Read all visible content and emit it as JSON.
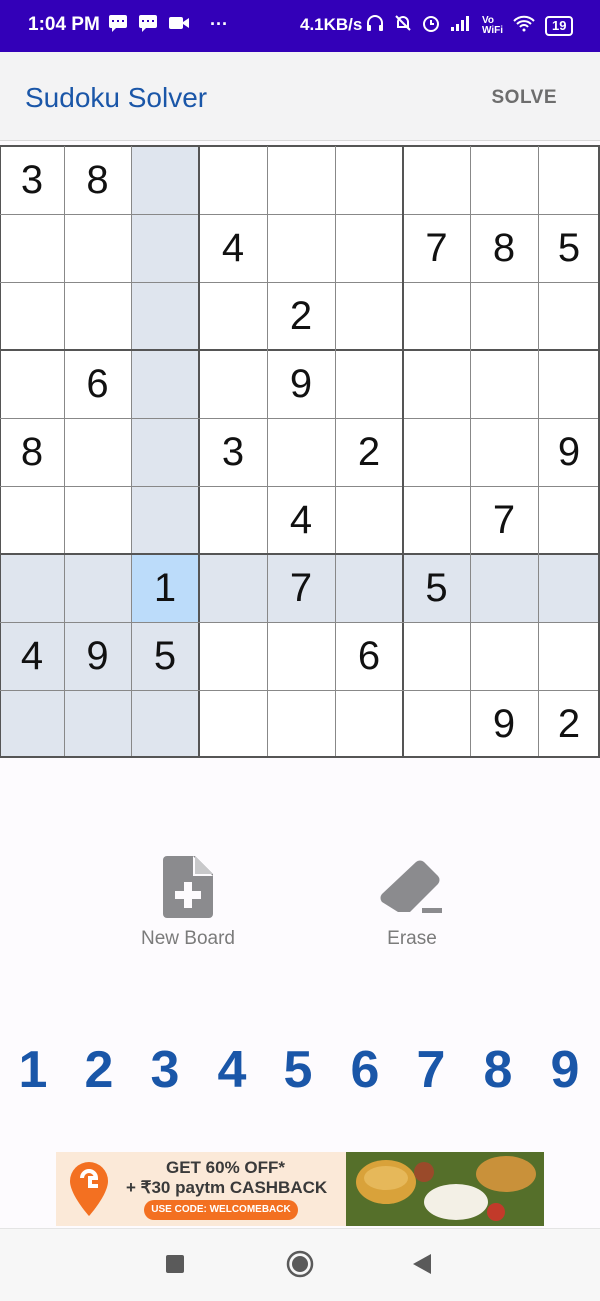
{
  "status_bar": {
    "time": "1:04 PM",
    "icons_left": [
      "message-icon",
      "message-icon",
      "video-icon",
      "more-icon"
    ],
    "more": "···",
    "speed": "4.1KB/s",
    "battery": "19"
  },
  "app_bar": {
    "title": "Sudoku Solver",
    "solve_label": "SOLVE"
  },
  "board": {
    "rows": [
      [
        "3",
        "8",
        "",
        "",
        "",
        "",
        "",
        "",
        ""
      ],
      [
        "",
        "",
        "",
        "4",
        "",
        "",
        "7",
        "8",
        "5"
      ],
      [
        "",
        "",
        "",
        "",
        "2",
        "",
        "",
        "",
        ""
      ],
      [
        "",
        "6",
        "",
        "",
        "9",
        "",
        "",
        "",
        ""
      ],
      [
        "8",
        "",
        "",
        "3",
        "",
        "2",
        "",
        "",
        "9"
      ],
      [
        "",
        "",
        "",
        "",
        "4",
        "",
        "",
        "7",
        ""
      ],
      [
        "",
        "",
        "1",
        "",
        "7",
        "",
        "5",
        "",
        ""
      ],
      [
        "4",
        "9",
        "5",
        "",
        "",
        "6",
        "",
        "",
        ""
      ],
      [
        "",
        "",
        "",
        "",
        "",
        "",
        "",
        "9",
        "2"
      ]
    ],
    "selected_cell": {
      "row": 6,
      "col": 2
    },
    "highlight_color": "#dfe5ee",
    "selected_color": "#bcdcfa"
  },
  "actions": {
    "new_board_label": "New Board",
    "erase_label": "Erase"
  },
  "number_pad": [
    "1",
    "2",
    "3",
    "4",
    "5",
    "6",
    "7",
    "8",
    "9"
  ],
  "ad": {
    "line1": "GET 60% OFF*",
    "line2": "+ ₹30 paytm CASHBACK",
    "code": "USE CODE: WELCOMEBACK"
  },
  "colors": {
    "status_bar": "#3300b8",
    "accent": "#1a56a8",
    "icon_gray": "#7b7b7b"
  }
}
